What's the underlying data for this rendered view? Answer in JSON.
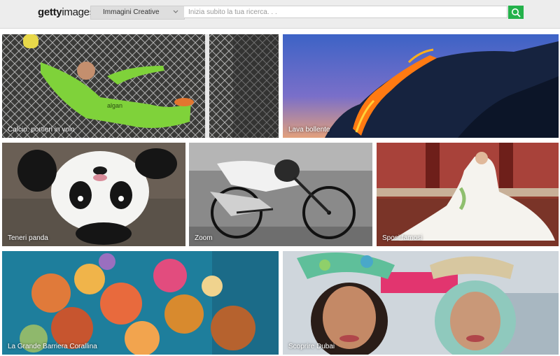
{
  "header": {
    "logo_bold": "getty",
    "logo_light": "images",
    "category_select": "Immagini Creative",
    "search_placeholder": "Inizia subito la tua ricerca. . ."
  },
  "tiles": [
    {
      "caption": "Calcio: portieri in volo"
    },
    {
      "caption": "Lava bollente"
    },
    {
      "caption": "Teneri panda"
    },
    {
      "caption": "Zoom"
    },
    {
      "caption": "Sposi famosi"
    },
    {
      "caption": "La Grande Barriera Corallina"
    },
    {
      "caption": "Scoprire Dubai"
    }
  ],
  "colors": {
    "search_button": "#24b24b",
    "header_bg": "#ededed"
  }
}
